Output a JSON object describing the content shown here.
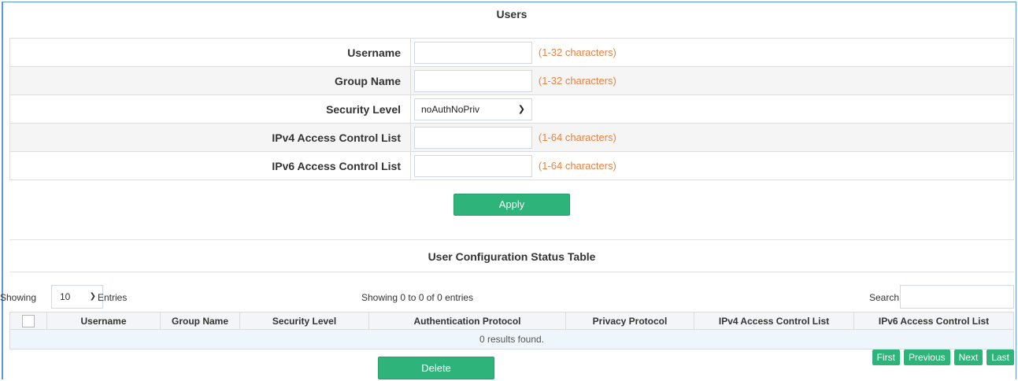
{
  "users": {
    "title": "Users",
    "fields": [
      {
        "label": "Username",
        "value": "",
        "hint": "(1-32 characters)"
      },
      {
        "label": "Group Name",
        "value": "",
        "hint": "(1-32 characters)"
      },
      {
        "label": "Security Level",
        "selected": "noAuthNoPriv"
      },
      {
        "label": "IPv4 Access Control List",
        "value": "",
        "hint": "(1-64 characters)"
      },
      {
        "label": "IPv6 Access Control List",
        "value": "",
        "hint": "(1-64 characters)"
      }
    ],
    "apply_label": "Apply"
  },
  "status_table": {
    "title": "User Configuration Status Table",
    "showing_label": "Showing",
    "entries_value": "10",
    "entries_label": "Entries",
    "info": "Showing 0 to 0 of 0 entries",
    "search_label": "Search",
    "search_value": "",
    "columns": [
      "Username",
      "Group Name",
      "Security Level",
      "Authentication Protocol",
      "Privacy Protocol",
      "IPv4 Access Control List",
      "IPv6 Access Control List"
    ],
    "empty_message": "0 results found.",
    "delete_label": "Delete",
    "pager": {
      "first": "First",
      "previous": "Previous",
      "next": "Next",
      "last": "Last"
    }
  },
  "colors": {
    "accent": "#2eb37b",
    "hint": "#f0803c",
    "frame": "#5b9bd5"
  }
}
